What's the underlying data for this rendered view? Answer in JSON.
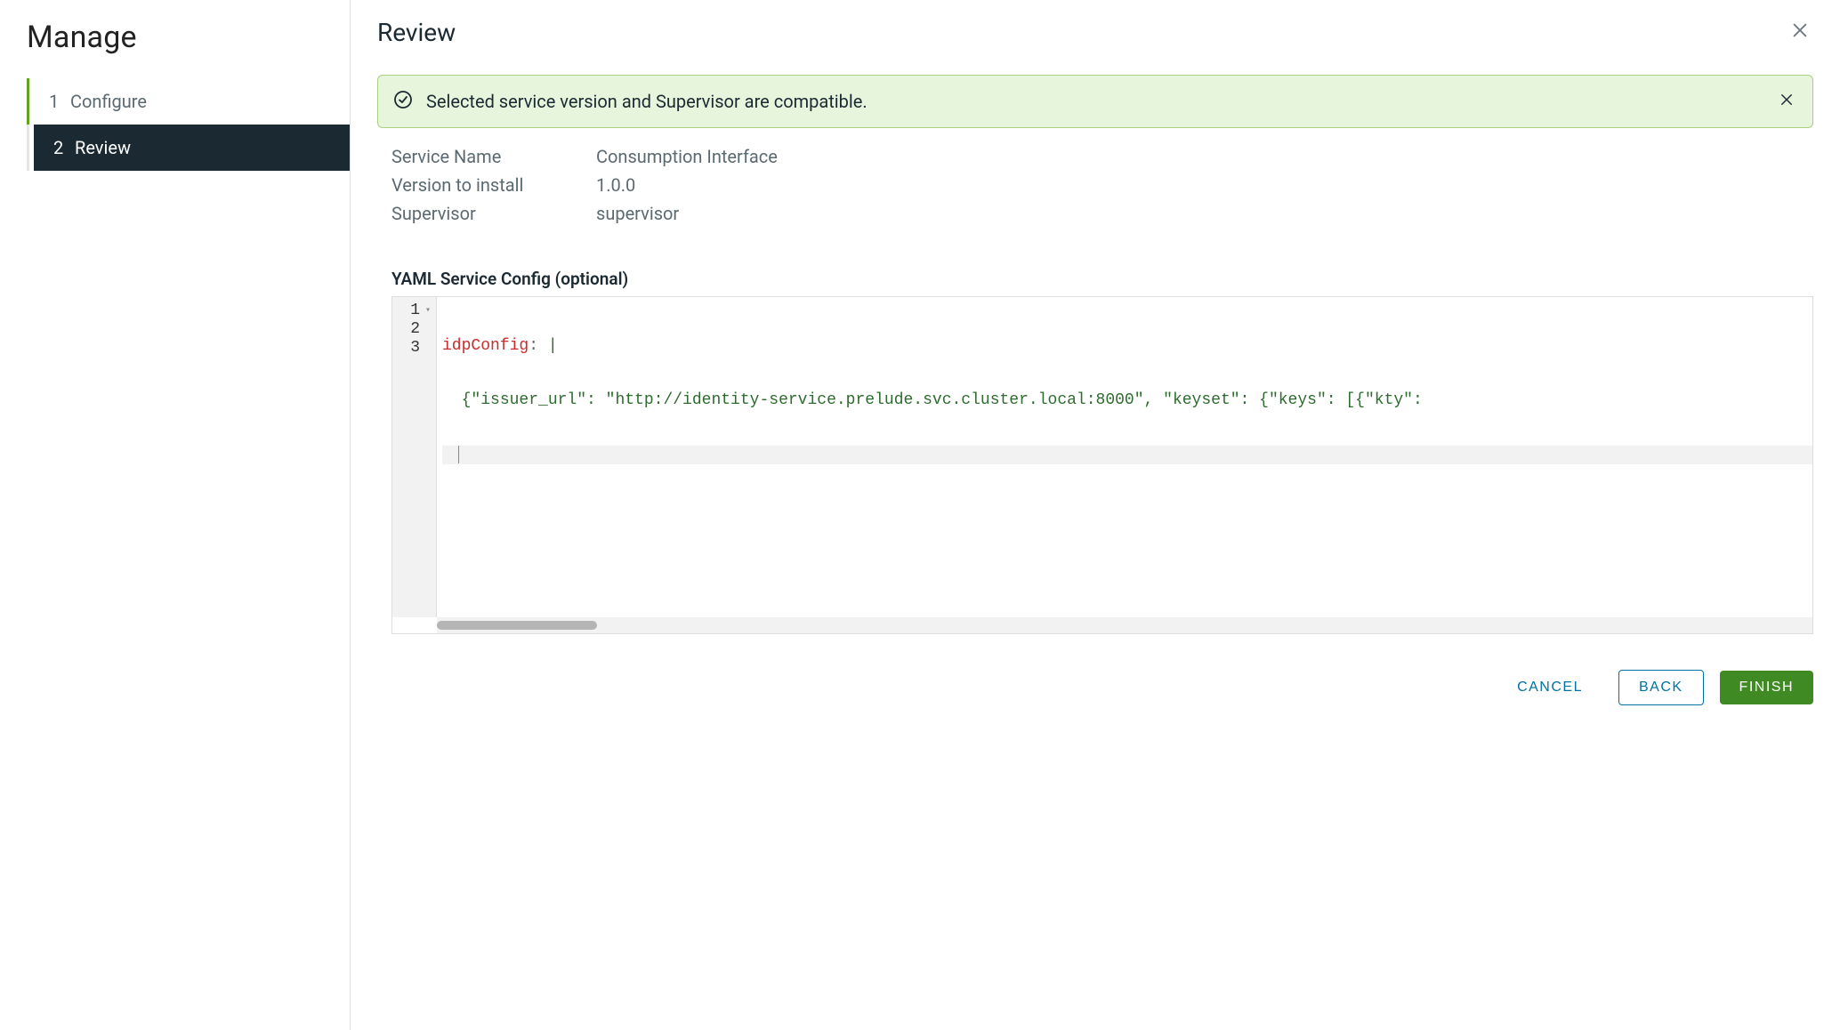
{
  "sidebar": {
    "title": "Manage",
    "steps": [
      {
        "num": "1",
        "label": "Configure"
      },
      {
        "num": "2",
        "label": "Review"
      }
    ]
  },
  "main": {
    "title": "Review",
    "alert": {
      "text": "Selected service version and Supervisor are compatible."
    },
    "info": {
      "service_name_label": "Service Name",
      "service_name_value": "Consumption Interface",
      "version_label": "Version to install",
      "version_value": "1.0.0",
      "supervisor_label": "Supervisor",
      "supervisor_value": "supervisor"
    },
    "yaml": {
      "label": "YAML Service Config (optional)",
      "gutter": [
        "1",
        "2",
        "3"
      ],
      "line1_key": "idpConfig",
      "line1_punc": ":",
      "line1_pipe": " |",
      "line2_indent": "  ",
      "line2_content": "{\"issuer_url\": \"http://identity-service.prelude.svc.cluster.local:8000\", \"keyset\": {\"keys\": [{\"kty\":"
    }
  },
  "footer": {
    "cancel": "CANCEL",
    "back": "BACK",
    "finish": "FINISH"
  }
}
